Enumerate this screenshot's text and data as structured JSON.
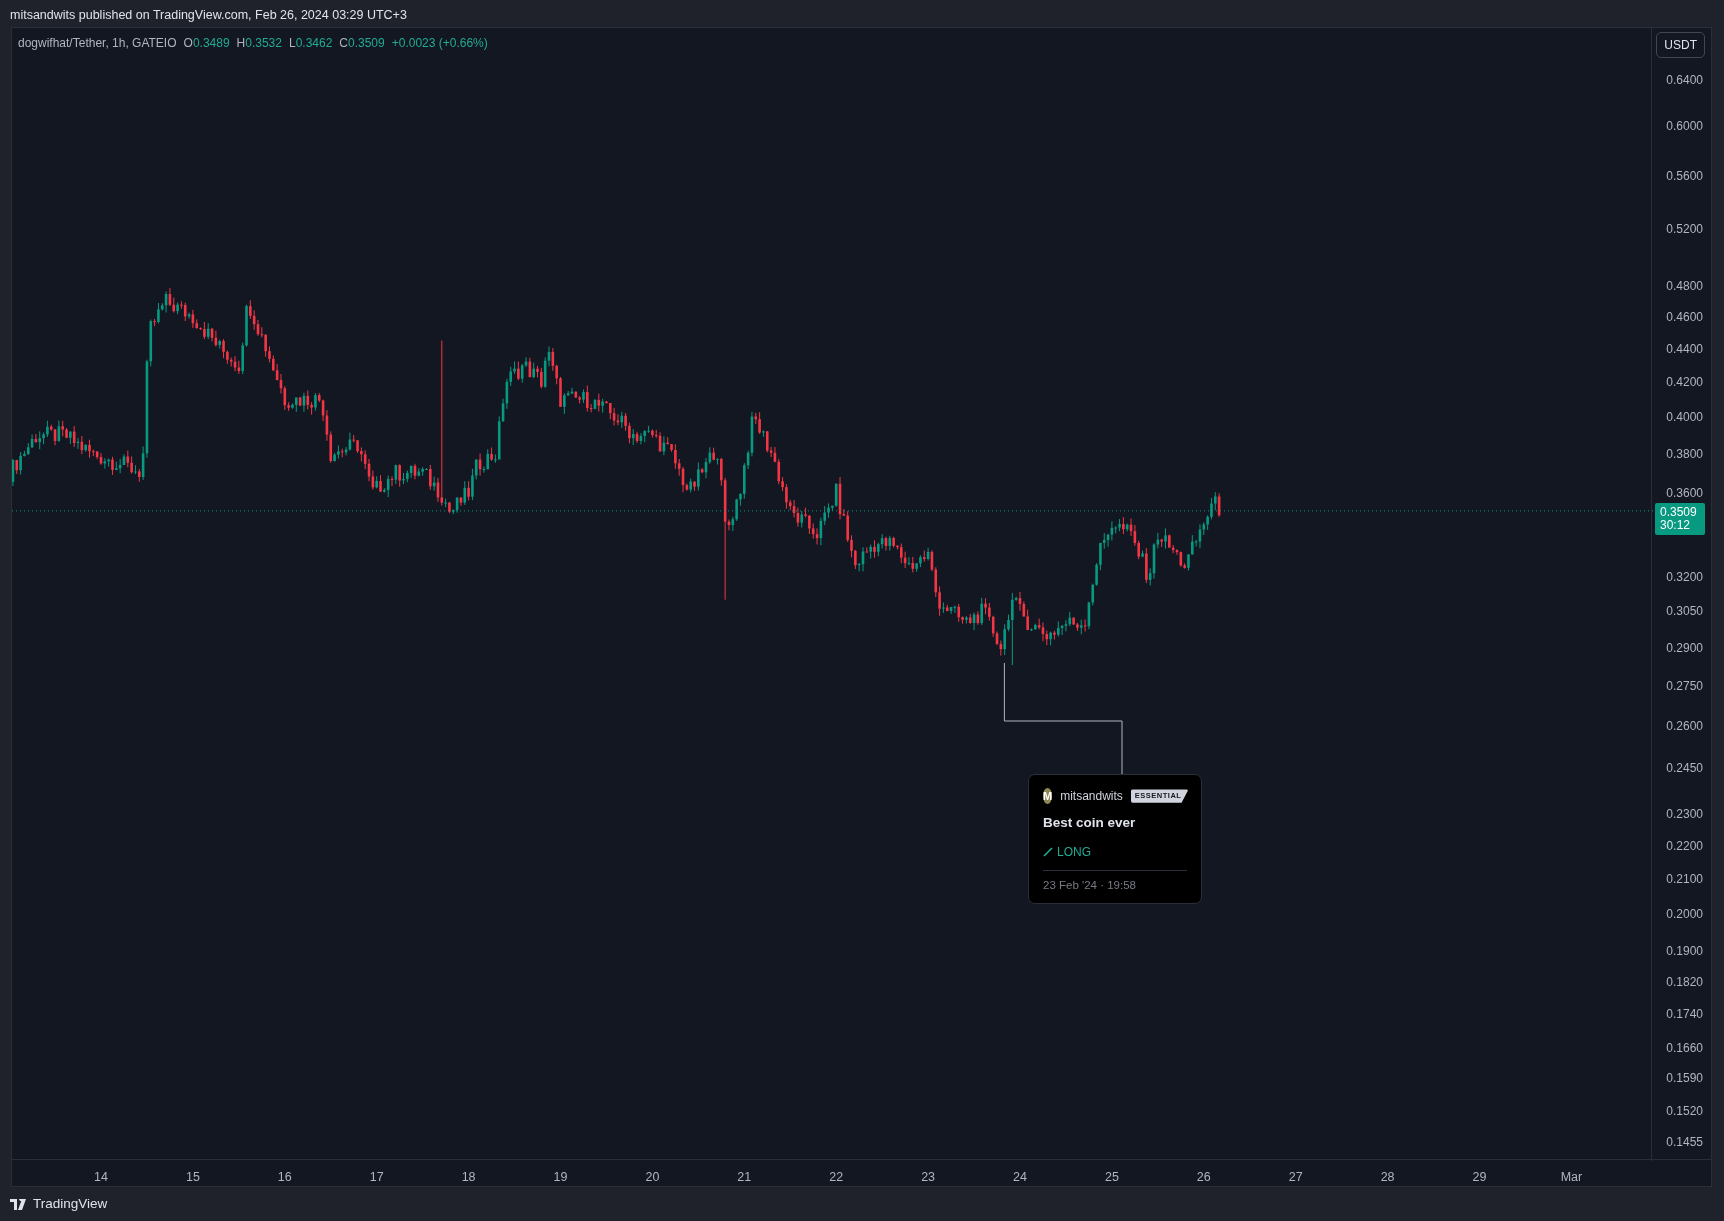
{
  "header": {
    "text": "mitsandwits published on TradingView.com, Feb 26, 2024 03:29 UTC+3"
  },
  "legend": {
    "symbol": "dogwifhat/Tether, 1h, GATEIO",
    "values": [
      {
        "key": "O",
        "value": "0.3489"
      },
      {
        "key": "H",
        "value": "0.3532"
      },
      {
        "key": "L",
        "value": "0.3462"
      },
      {
        "key": "C",
        "value": "0.3509"
      }
    ],
    "change": "+0.0023 (+0.66%)"
  },
  "currency_button": "USDT",
  "price_axis": [
    "0.6400",
    "0.6000",
    "0.5600",
    "0.5200",
    "0.4800",
    "0.4600",
    "0.4400",
    "0.4200",
    "0.4000",
    "0.3800",
    "0.3600",
    "0.3200",
    "0.3050",
    "0.2900",
    "0.2750",
    "0.2600",
    "0.2450",
    "0.2300",
    "0.2200",
    "0.2100",
    "0.2000",
    "0.1900",
    "0.1820",
    "0.1740",
    "0.1660",
    "0.1590",
    "0.1520",
    "0.1455"
  ],
  "time_axis": [
    "14",
    "15",
    "16",
    "17",
    "18",
    "19",
    "20",
    "21",
    "22",
    "23",
    "24",
    "25",
    "26",
    "27",
    "28",
    "29",
    "Mar"
  ],
  "last_price": {
    "price": "0.3509",
    "countdown": "30:12"
  },
  "idea": {
    "avatar": "M",
    "author": "mitsandwits",
    "badge": "ESSENTIAL",
    "title": "Best coin ever",
    "direction": {
      "kind": "long",
      "label": "LONG"
    },
    "date": "23 Feb '24 · 19:58"
  },
  "footer": {
    "brand": "TradingView"
  }
}
